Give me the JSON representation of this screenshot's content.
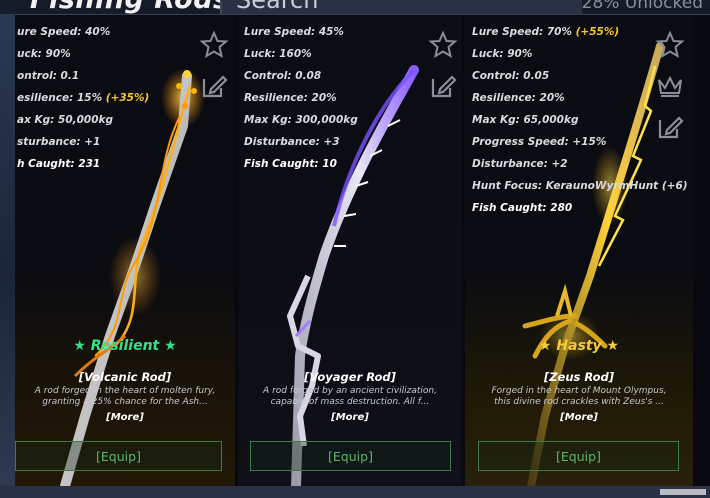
{
  "header": {
    "title": "Fishing Rods",
    "search_placeholder": "Search",
    "unlocked": "28% Unlocked"
  },
  "cards": [
    {
      "stats": [
        {
          "text": "ure Speed: 40%"
        },
        {
          "text": "uck: 90%"
        },
        {
          "text": "ontrol: 0.1"
        },
        {
          "text": "esilience: 15%",
          "bonus": "(+35%)"
        },
        {
          "text": "ax Kg: 50,000kg"
        },
        {
          "text": "sturbance: +1"
        },
        {
          "text": "h Caught: 231"
        }
      ],
      "mutation": "Resilient",
      "mutation_color": "#35e08a",
      "name": "[Volcanic Rod]",
      "desc1": "A rod forged in the heart of molten fury,",
      "desc2": "granting a 25% chance for the Ash...",
      "more": "[More]",
      "equip": "[Equip]",
      "icons": [
        "star-icon",
        "edit-icon"
      ]
    },
    {
      "stats": [
        {
          "text": "Lure Speed: 45%"
        },
        {
          "text": "Luck: 160%"
        },
        {
          "text": "Control: 0.08"
        },
        {
          "text": "Resilience: 20%"
        },
        {
          "text": "Max Kg: 300,000kg"
        },
        {
          "text": "Disturbance: +3"
        },
        {
          "text": "Fish Caught: 10"
        }
      ],
      "mutation": "",
      "name": "[Voyager Rod]",
      "desc1": "A rod forged by an ancient civilization,",
      "desc2": "capable of mass destruction. All f...",
      "more": "[More]",
      "equip": "[Equip]",
      "icons": [
        "star-icon",
        "edit-icon"
      ]
    },
    {
      "stats": [
        {
          "text": "Lure Speed: 70%",
          "bonus": "(+55%)"
        },
        {
          "text": "Luck: 90%"
        },
        {
          "text": "Control: 0.05"
        },
        {
          "text": "Resilience: 20%"
        },
        {
          "text": "Max Kg: 65,000kg"
        },
        {
          "text": "Progress Speed: +15%"
        },
        {
          "text": "Disturbance: +2"
        },
        {
          "text": "Hunt Focus: KeraunoWyrmHunt (+6)"
        },
        {
          "text": "Fish Caught: 280"
        }
      ],
      "mutation": "Hasty",
      "mutation_color": "#f5cc3a",
      "name": "[Zeus Rod]",
      "desc1": "Forged in the heart of Mount Olympus,",
      "desc2": "this divine rod crackles with Zeus's ...",
      "more": "[More]",
      "equip": "[Equip]",
      "icons": [
        "star-icon",
        "crown-icon",
        "edit-icon"
      ]
    }
  ]
}
